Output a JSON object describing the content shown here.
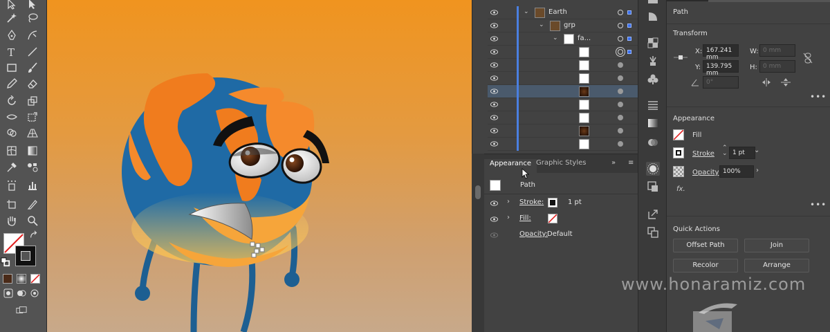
{
  "layers": {
    "rows": [
      {
        "name": "Earth",
        "thumb": "earth-thumb",
        "expanded": true
      },
      {
        "name": "grp",
        "thumb": "earth-thumb",
        "expanded": true
      },
      {
        "name": "fa...",
        "thumb": "face-thumb",
        "expanded": true
      },
      {
        "name": "",
        "thumb": "blank-thumb"
      },
      {
        "name": "",
        "thumb": "shape-thumb"
      },
      {
        "name": "",
        "thumb": "shape-thumb"
      },
      {
        "name": "",
        "thumb": "eye-thumb",
        "selected": true
      },
      {
        "name": "",
        "thumb": "shape-thumb"
      },
      {
        "name": "",
        "thumb": "shape-thumb"
      },
      {
        "name": "",
        "thumb": "eye-thumb"
      },
      {
        "name": "",
        "thumb": "shape-thumb"
      }
    ]
  },
  "appearance": {
    "tabs": [
      "Appearance",
      "Graphic Styles"
    ],
    "active_tab": "Appearance",
    "object_label": "Path",
    "stroke_label": "Stroke:",
    "stroke_value": "1 pt",
    "fill_label": "Fill:",
    "opacity_label": "Opacity:",
    "opacity_value": "Default"
  },
  "properties": {
    "header": "Path",
    "transform_title": "Transform",
    "x_label": "X:",
    "x_value": "167.241 mm",
    "y_label": "Y:",
    "y_value": "139.795 mm",
    "w_label": "W:",
    "w_value": "0 mm",
    "h_label": "H:",
    "h_value": "0 mm",
    "angle_value": "0°",
    "appearance_title": "Appearance",
    "fill_label": "Fill",
    "stroke_label": "Stroke",
    "stroke_value": "1 pt",
    "opacity_label": "Opacity",
    "opacity_value": "100%",
    "fx_label": "fx.",
    "quick_actions_title": "Quick Actions",
    "buttons": [
      "Offset Path",
      "Join",
      "Recolor",
      "Arrange"
    ]
  },
  "watermark": "www.honaramiz.com",
  "colors": {
    "ocean": "#1f6aa5",
    "land": "#f07c1e",
    "canvas_top": "#f0941f",
    "selection": "#4a7fe0"
  }
}
